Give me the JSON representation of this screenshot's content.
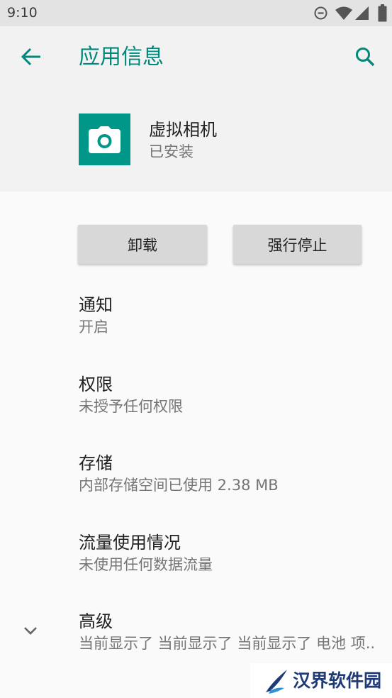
{
  "status_bar": {
    "time": "9:10",
    "icons": [
      "do-not-disturb-icon",
      "wifi-icon",
      "cell-signal-icon",
      "battery-icon"
    ]
  },
  "app_bar": {
    "title": "应用信息",
    "back_icon": "arrow-left-icon",
    "search_icon": "search-icon"
  },
  "app": {
    "name": "虚拟相机",
    "status": "已安装",
    "icon": "camera-icon"
  },
  "buttons": {
    "uninstall": "卸载",
    "force_stop": "强行停止"
  },
  "items": [
    {
      "title": "通知",
      "summary": "开启"
    },
    {
      "title": "权限",
      "summary": "未授予任何权限"
    },
    {
      "title": "存储",
      "summary": "内部存储空间已使用 2.38 MB"
    },
    {
      "title": "流量使用情况",
      "summary": "未使用任何数据流量"
    },
    {
      "title": "高级",
      "summary": "当前显示了 当前显示了 当前显示了 电池 项..",
      "icon": "chevron-down-icon"
    }
  ],
  "watermark": {
    "text": "汉界软件园"
  },
  "colors": {
    "accent": "#00897b",
    "app_icon_bg": "#009688",
    "header_bg": "#f2f2f2",
    "status_bar_bg": "#e3e3e3",
    "content_bg": "#fafafa",
    "button_bg": "#d8d8d8",
    "primary_text": "#212121",
    "secondary_text": "#757575",
    "watermark_text": "#1e3a78"
  }
}
